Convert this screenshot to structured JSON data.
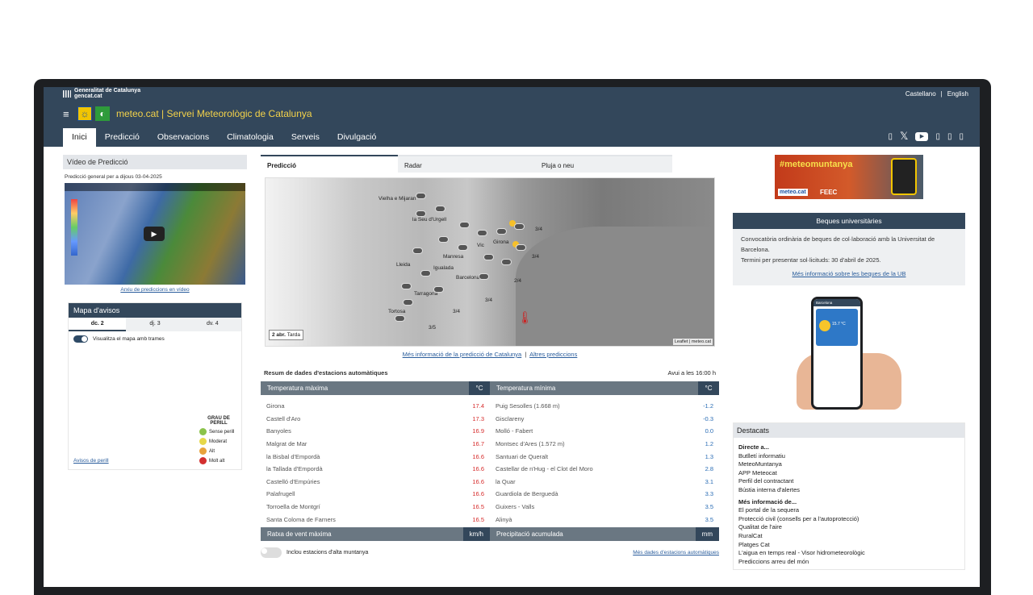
{
  "topbar": {
    "brand_line1": "Generalitat de Catalunya",
    "brand_line2": "gencat.cat",
    "lang_es": "Castellano",
    "lang_sep": "|",
    "lang_en": "English"
  },
  "header": {
    "menu_icon": "hamburger-icon",
    "title": "meteo.cat | Servei Meteorològic de Catalunya"
  },
  "nav": {
    "items": [
      "Inici",
      "Predicció",
      "Observacions",
      "Climatologia",
      "Serveis",
      "Divulgació"
    ],
    "active": "Inici"
  },
  "social": {
    "icons": [
      "facebook-icon",
      "x-icon",
      "youtube-icon",
      "instagram-icon",
      "linkedin-icon",
      "rss-icon"
    ]
  },
  "video": {
    "title": "Vídeo de Predicció",
    "caption": "Predicció general per a dijous 03-04-2025",
    "archive_link": "Arxiu de prediccions en vídeo"
  },
  "warnings": {
    "title": "Mapa d'avisos",
    "tabs": [
      "dc. 2",
      "dj. 3",
      "dv. 4"
    ],
    "toggle_label": "Visualitza el mapa amb trames",
    "legend_title": "GRAU DE PERILL",
    "legend": [
      {
        "label": "Sense perill",
        "color": "#8bc34a"
      },
      {
        "label": "Moderat",
        "color": "#e6d84a"
      },
      {
        "label": "Alt",
        "color": "#e8a33c"
      },
      {
        "label": "Molt alt",
        "color": "#d32f2f"
      }
    ],
    "link": "Avisos de perill"
  },
  "forecast": {
    "tabs": [
      "Predicció",
      "Radar",
      "Pluja o neu"
    ],
    "active_tab": "Predicció",
    "date_label": "2 abr.",
    "period_label": "Tarda",
    "attribution": "Leaflet | meteo.cat",
    "cities": [
      "Vielha e Mijaran",
      "la Seu d'Urgell",
      "Girona",
      "Vic",
      "Manresa",
      "Lleida",
      "Barcelona",
      "Tarragona",
      "Igualada",
      "Tortosa"
    ],
    "wave_labels": [
      "3/4",
      "3/4",
      "2/4",
      "3/4",
      "3/4",
      "3/5"
    ],
    "link_more": "Més informació de la predicció de Catalunya",
    "link_sep": "|",
    "link_other": "Altres prediccions"
  },
  "summary": {
    "title": "Resum de dades d'estacions automàtiques",
    "updated": "Avui a les 16:00 h",
    "max_header": "Temperatura màxima",
    "min_header": "Temperatura mínima",
    "unit_c": "°C",
    "max_rows": [
      {
        "name": "Girona",
        "value": "17.4"
      },
      {
        "name": "Castell d'Aro",
        "value": "17.3"
      },
      {
        "name": "Banyoles",
        "value": "16.9"
      },
      {
        "name": "Malgrat de Mar",
        "value": "16.7"
      },
      {
        "name": "la Bisbal d'Empordà",
        "value": "16.6"
      },
      {
        "name": "la Tallada d'Empordà",
        "value": "16.6"
      },
      {
        "name": "Castelló d'Empúries",
        "value": "16.6"
      },
      {
        "name": "Palafrugell",
        "value": "16.6"
      },
      {
        "name": "Torroella de Montgrí",
        "value": "16.5"
      },
      {
        "name": "Santa Coloma de Farners",
        "value": "16.5"
      }
    ],
    "min_rows": [
      {
        "name": "Puig Sesolles (1.668 m)",
        "value": "-1.2"
      },
      {
        "name": "Gisclareny",
        "value": "-0.3"
      },
      {
        "name": "Molló - Fabert",
        "value": "0.0"
      },
      {
        "name": "Montsec d'Ares (1.572 m)",
        "value": "1.2"
      },
      {
        "name": "Santuari de Queralt",
        "value": "1.3"
      },
      {
        "name": "Castellar de n'Hug - el Clot del Moro",
        "value": "2.8"
      },
      {
        "name": "la Quar",
        "value": "3.1"
      },
      {
        "name": "Guardiola de Berguedà",
        "value": "3.3"
      },
      {
        "name": "Guixers - Valls",
        "value": "3.5"
      },
      {
        "name": "Alinyà",
        "value": "3.5"
      }
    ],
    "wind_header": "Ratxa de vent màxima",
    "wind_unit": "km/h",
    "rain_header": "Precipitació acumulada",
    "rain_unit": "mm",
    "toggle_label": "Inclou estacions d'alta muntanya",
    "more_link": "Més dades d'estacions automàtiques"
  },
  "banner": {
    "title": "#meteomuntanya",
    "logo_text": "meteo.cat",
    "partner": "FEEC"
  },
  "beques": {
    "title": "Beques universitàries",
    "line1": "Convocatòria ordinària de beques de col·laboració amb la Universitat de Barcelona.",
    "line2": "Termini per presentar sol·licituds: 30 d'abril de 2025.",
    "link": "Més informació sobre les beques de la UB"
  },
  "app_promo": {
    "city": "Barcelona",
    "temp": "15.7 °C"
  },
  "destacats": {
    "title": "Destacats",
    "section1": "Directe a...",
    "items1": [
      "Butlletí informatiu",
      "MeteoMuntanya",
      "APP Meteocat",
      "Perfil del contractant",
      "Bústia interna d'alertes"
    ],
    "section2": "Més informació de...",
    "items2": [
      "El portal de la sequera",
      "Protecció civil (consells per a l'autoprotecció)",
      "Qualitat de l'aire",
      "RuralCat",
      "Platges Cat",
      "L'aigua en temps real - Visor hidrometeorològic",
      "Prediccions arreu del món"
    ]
  }
}
